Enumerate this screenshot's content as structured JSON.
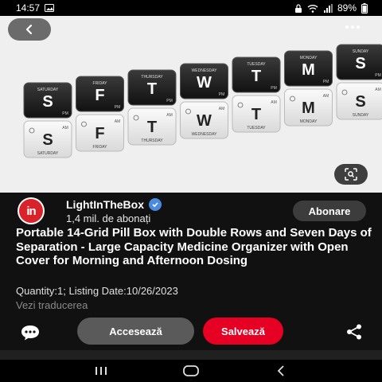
{
  "status_bar": {
    "time": "14:57",
    "battery": "89%",
    "icons": [
      "image-icon",
      "lock-icon",
      "wifi-icon",
      "signal-icon",
      "battery-icon"
    ]
  },
  "image": {
    "description_icons": [
      "back-arrow-icon",
      "more-icon",
      "lens-search-icon"
    ],
    "top_row_days": [
      "S",
      "F",
      "T",
      "W",
      "T",
      "M",
      "S"
    ],
    "top_row_labels": [
      "SATURDAY",
      "FRIDAY",
      "THURSDAY",
      "WEDNESDAY",
      "TUESDAY",
      "MONDAY",
      "SUNDAY"
    ],
    "bottom_row_days": [
      "S",
      "F",
      "T",
      "W",
      "T",
      "M",
      "S"
    ],
    "bottom_row_labels": [
      "SATURDAY",
      "FRIDAY",
      "THURSDAY",
      "WEDNESDAY",
      "TUESDAY",
      "MONDAY",
      "SUNDAY"
    ],
    "pm": "PM",
    "am": "AM"
  },
  "store": {
    "logo_text": "in",
    "name": "LightInTheBox",
    "subscribers": "1,4 mil. de abonați",
    "follow_label": "Abonare"
  },
  "product": {
    "title": "Portable 14-Grid Pill Box with Double Rows and Seven Days of Separation - Large Capacity Medicine Organizer with Open Cover for Morning and Afternoon Dosing",
    "meta": "Quantity:1; Listing Date:10/26/2023",
    "translate": "Vezi traducerea"
  },
  "actions": {
    "open_label": "Accesează",
    "save_label": "Salvează"
  },
  "colors": {
    "save_red": "#e60023",
    "logo_red": "#d8232a",
    "verified_blue": "#4a8be0"
  }
}
